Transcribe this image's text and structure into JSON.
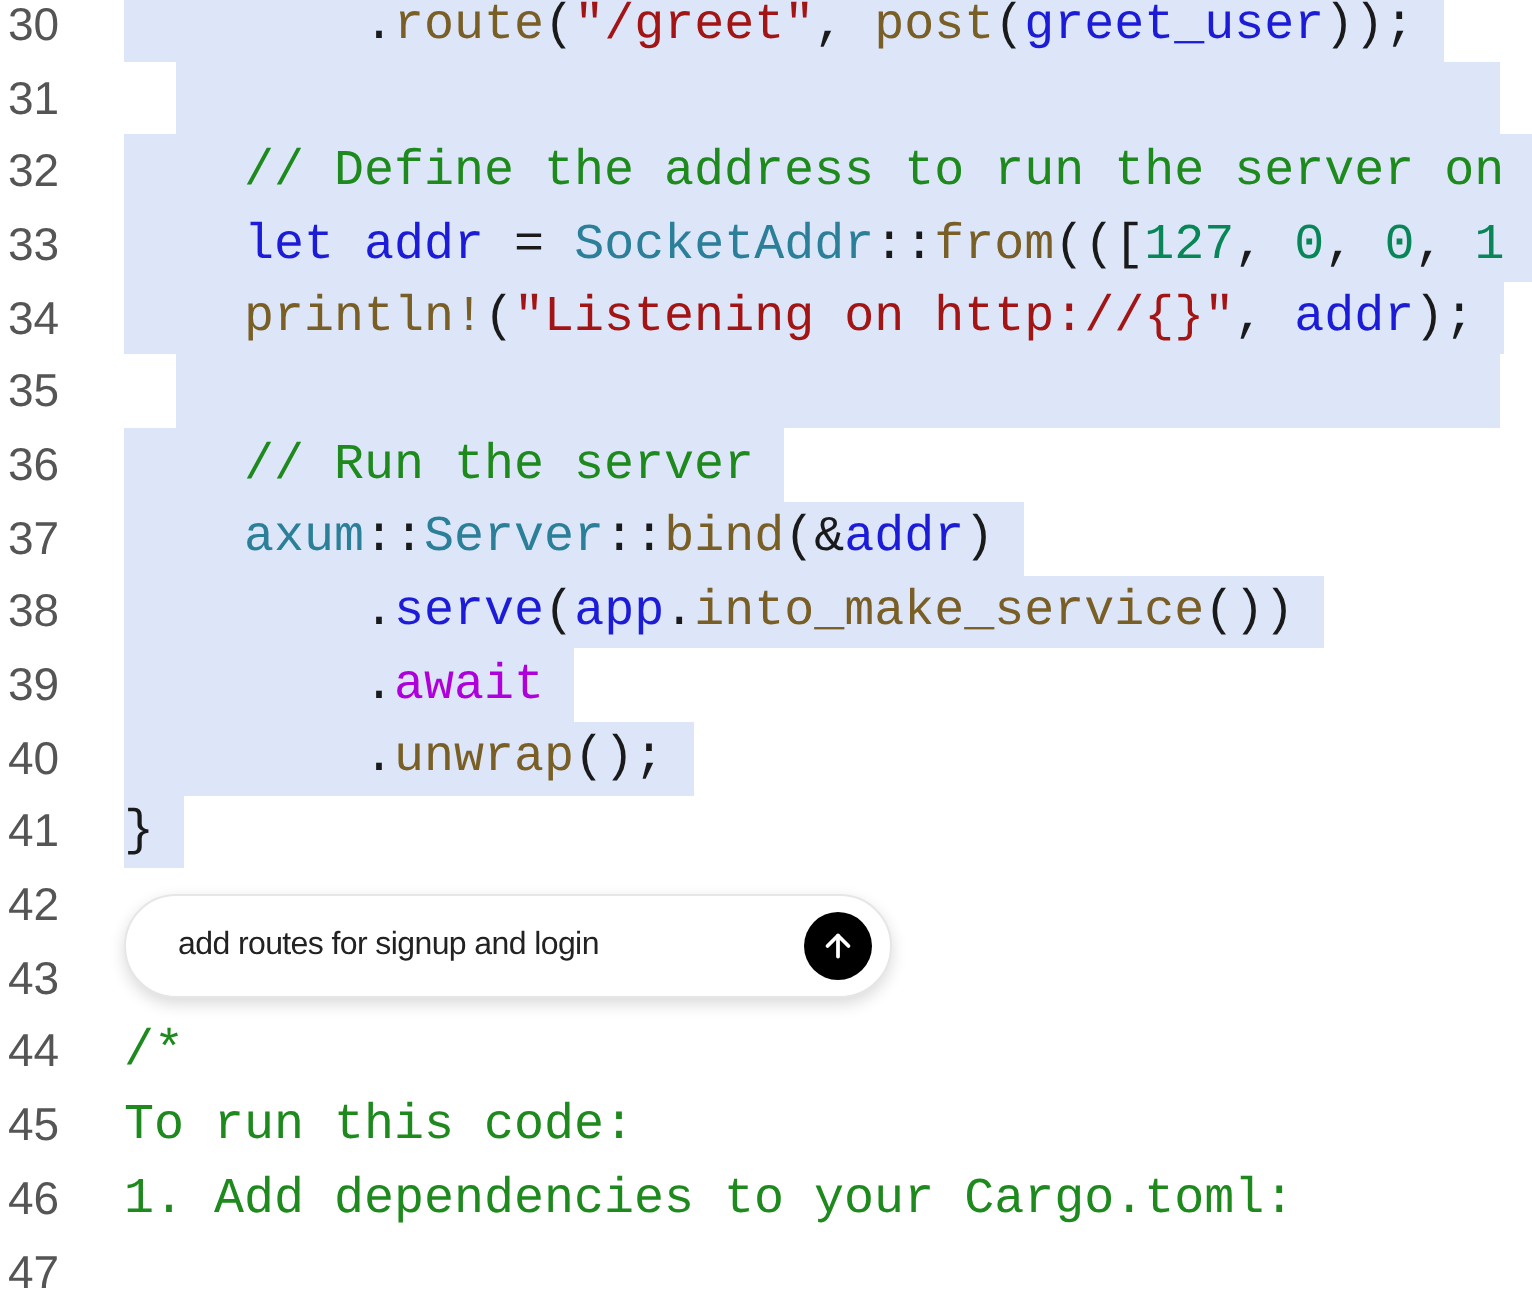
{
  "editor": {
    "lines": [
      {
        "number": "30",
        "selected": true,
        "tokens": [
          {
            "kind": "plain",
            "text": "        ."
          },
          {
            "kind": "function",
            "text": "route"
          },
          {
            "kind": "plain",
            "text": "("
          },
          {
            "kind": "string",
            "text": "\"/greet\""
          },
          {
            "kind": "plain",
            "text": ", "
          },
          {
            "kind": "function",
            "text": "post"
          },
          {
            "kind": "plain",
            "text": "("
          },
          {
            "kind": "variable",
            "text": "greet_user"
          },
          {
            "kind": "plain",
            "text": "));"
          }
        ]
      },
      {
        "number": "31",
        "selected": true
      },
      {
        "number": "32",
        "selected": true,
        "tokens": [
          {
            "kind": "comment",
            "text": "    // Define the address to run the server on"
          }
        ]
      },
      {
        "number": "33",
        "selected": true,
        "tokens": [
          {
            "kind": "keyword",
            "text": "    let"
          },
          {
            "kind": "variable",
            "text": " addr"
          },
          {
            "kind": "plain",
            "text": " = "
          },
          {
            "kind": "type",
            "text": "SocketAddr"
          },
          {
            "kind": "plain",
            "text": "::"
          },
          {
            "kind": "function",
            "text": "from"
          },
          {
            "kind": "plain",
            "text": "((["
          },
          {
            "kind": "number",
            "text": "127"
          },
          {
            "kind": "plain",
            "text": ", "
          },
          {
            "kind": "number",
            "text": "0"
          },
          {
            "kind": "plain",
            "text": ", "
          },
          {
            "kind": "number",
            "text": "0"
          },
          {
            "kind": "plain",
            "text": ", "
          },
          {
            "kind": "number",
            "text": "1"
          }
        ]
      },
      {
        "number": "34",
        "selected": true,
        "tokens": [
          {
            "kind": "function",
            "text": "    println!"
          },
          {
            "kind": "plain",
            "text": "("
          },
          {
            "kind": "string",
            "text": "\"Listening on http://{}\""
          },
          {
            "kind": "plain",
            "text": ", "
          },
          {
            "kind": "variable",
            "text": "addr"
          },
          {
            "kind": "plain",
            "text": ");"
          }
        ]
      },
      {
        "number": "35",
        "selected": true
      },
      {
        "number": "36",
        "selected": true,
        "tokens": [
          {
            "kind": "comment",
            "text": "    // Run the server"
          }
        ]
      },
      {
        "number": "37",
        "selected": true,
        "tokens": [
          {
            "kind": "type",
            "text": "    axum"
          },
          {
            "kind": "plain",
            "text": "::"
          },
          {
            "kind": "type",
            "text": "Server"
          },
          {
            "kind": "plain",
            "text": "::"
          },
          {
            "kind": "function",
            "text": "bind"
          },
          {
            "kind": "plain",
            "text": "(&"
          },
          {
            "kind": "variable",
            "text": "addr"
          },
          {
            "kind": "plain",
            "text": ")"
          }
        ]
      },
      {
        "number": "38",
        "selected": true,
        "tokens": [
          {
            "kind": "plain",
            "text": "        ."
          },
          {
            "kind": "variable",
            "text": "serve"
          },
          {
            "kind": "plain",
            "text": "("
          },
          {
            "kind": "variable",
            "text": "app"
          },
          {
            "kind": "plain",
            "text": "."
          },
          {
            "kind": "function",
            "text": "into_make_service"
          },
          {
            "kind": "plain",
            "text": "())"
          }
        ]
      },
      {
        "number": "39",
        "selected": true,
        "tokens": [
          {
            "kind": "plain",
            "text": "        ."
          },
          {
            "kind": "control",
            "text": "await"
          }
        ]
      },
      {
        "number": "40",
        "selected": true,
        "tokens": [
          {
            "kind": "plain",
            "text": "        ."
          },
          {
            "kind": "function",
            "text": "unwrap"
          },
          {
            "kind": "plain",
            "text": "();"
          }
        ]
      },
      {
        "number": "41",
        "selected": true,
        "tokens": [
          {
            "kind": "plain",
            "text": "}"
          }
        ]
      },
      {
        "number": "42",
        "selected": false
      },
      {
        "number": "43",
        "selected": false
      },
      {
        "number": "44",
        "selected": false,
        "tokens": [
          {
            "kind": "comment",
            "text": "/*"
          }
        ]
      },
      {
        "number": "45",
        "selected": false,
        "tokens": [
          {
            "kind": "comment",
            "text": "To run this code:"
          }
        ]
      },
      {
        "number": "46",
        "selected": false,
        "tokens": [
          {
            "kind": "comment",
            "text": "1. Add dependencies to your Cargo.toml:"
          }
        ]
      },
      {
        "number": "47",
        "selected": false
      }
    ]
  },
  "prompt": {
    "value": "add routes for signup and login"
  }
}
